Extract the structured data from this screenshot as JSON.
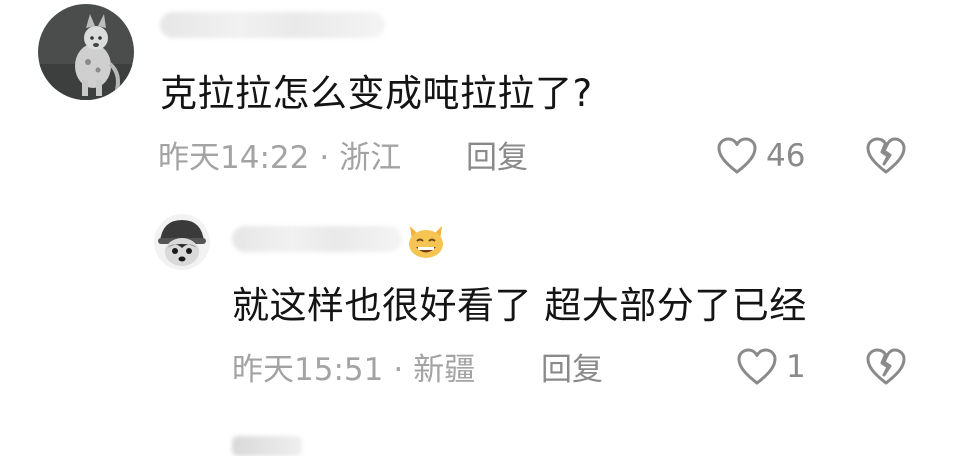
{
  "comments": [
    {
      "avatar": "dog-photo-avatar",
      "text": "克拉拉怎么变成吨拉拉了?",
      "time": "昨天14:22",
      "separator": "·",
      "location": "浙江",
      "reply_label": "回复",
      "like_count": "46",
      "like_icon": "heart-outline-icon",
      "dislike_icon": "broken-heart-icon"
    },
    {
      "avatar": "husky-avatar",
      "name_emoji": "cat-face-emoji-icon",
      "text": "就这样也很好看了 超大部分了已经",
      "time": "昨天15:51",
      "separator": "·",
      "location": "新疆",
      "reply_label": "回复",
      "like_count": "1",
      "like_icon": "heart-outline-icon",
      "dislike_icon": "broken-heart-icon"
    }
  ],
  "colors": {
    "text": "#141414",
    "meta": "#a3a3a3",
    "action": "#8a8a8a",
    "background": "#ffffff"
  }
}
